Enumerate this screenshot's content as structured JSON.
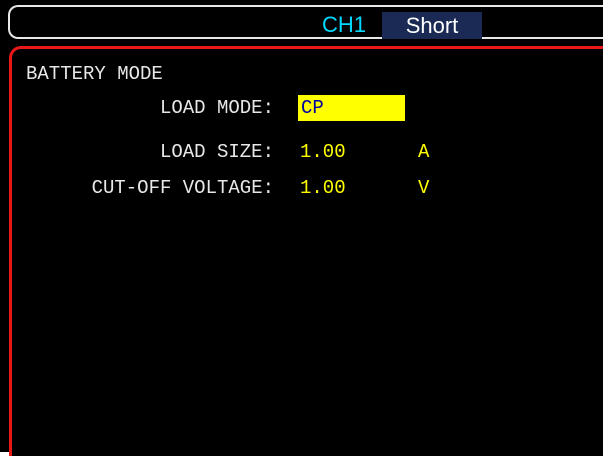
{
  "header": {
    "channel": "CH1",
    "mode_tag": "Short"
  },
  "screen": {
    "title": "BATTERY MODE",
    "fields": [
      {
        "label": "LOAD MODE:",
        "value": "CP",
        "unit": ""
      },
      {
        "label": "LOAD SIZE:",
        "value": "1.00",
        "unit": "A"
      },
      {
        "label": "CUT-OFF VOLTAGE:",
        "value": "1.00",
        "unit": "V"
      }
    ]
  },
  "colors": {
    "label": "#e8e8e8",
    "value": "#ffff00",
    "highlight_bg": "#ffff00",
    "highlight_text": "#0000a0",
    "channel": "#00d8ff",
    "frame": "#e81818"
  }
}
